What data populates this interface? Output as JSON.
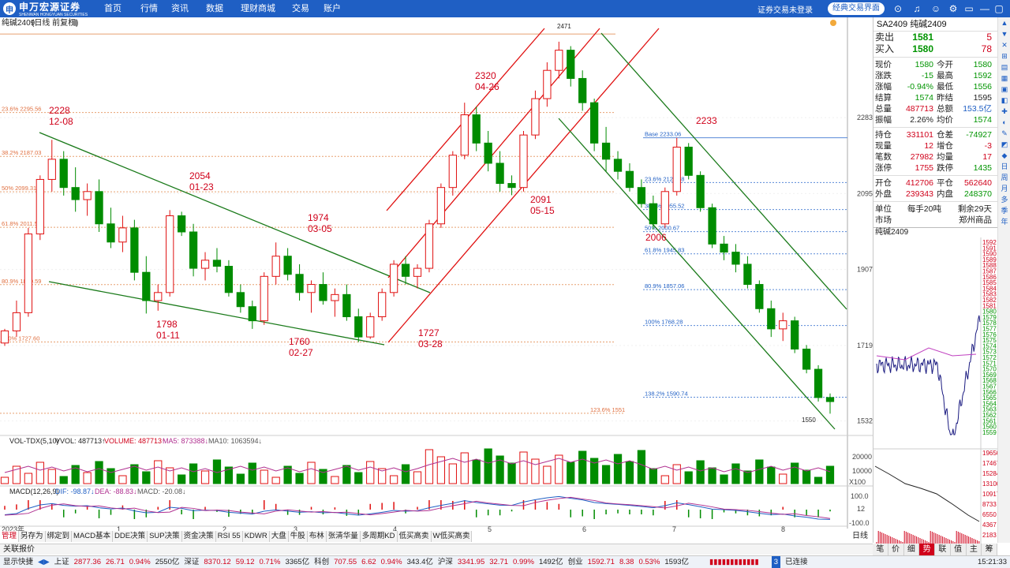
{
  "app": {
    "brand": "申万宏源证券",
    "brand_en": "SHENWAN HONGYUAN SECURITIES",
    "brand_short": "申"
  },
  "nav": [
    "首页",
    "行情",
    "资讯",
    "数据",
    "理财商城",
    "交易",
    "账户"
  ],
  "topbar": {
    "login_status": "证券交易未登录",
    "classic_button": "经典交易界面"
  },
  "window_controls": [
    "⊙",
    "♫",
    "☺",
    "⚙",
    "▭",
    "—",
    "▢",
    "✕"
  ],
  "colors": {
    "accent": "#1f5fc4",
    "up": "#d0021b",
    "down": "#009400",
    "fib": "#e07040"
  },
  "chart_header": {
    "symbol_label": "纯碱2409",
    "mode": "(日线 前复权)"
  },
  "chart_data": [
    {
      "type": "candlestick",
      "title": "纯碱2409",
      "y_axis_ticks": [
        "2283",
        "2095",
        "1907",
        "1719",
        "1532"
      ],
      "x_axis_ticks": [
        "2023年",
        "1",
        "2",
        "3",
        "4",
        "5",
        "6",
        "7",
        "8"
      ],
      "candles": [
        {
          "o": 1725,
          "h": 1760,
          "l": 1718,
          "c": 1755
        },
        {
          "o": 1755,
          "h": 1830,
          "l": 1740,
          "c": 1800
        },
        {
          "o": 1800,
          "h": 2010,
          "l": 1790,
          "c": 1995
        },
        {
          "o": 1995,
          "h": 2140,
          "l": 1980,
          "c": 2130
        },
        {
          "o": 2130,
          "h": 2228,
          "l": 2100,
          "c": 2180
        },
        {
          "o": 2180,
          "h": 2200,
          "l": 2090,
          "c": 2110
        },
        {
          "o": 2110,
          "h": 2160,
          "l": 2050,
          "c": 2080
        },
        {
          "o": 2080,
          "h": 2120,
          "l": 2040,
          "c": 2100
        },
        {
          "o": 2100,
          "h": 2130,
          "l": 2000,
          "c": 2020
        },
        {
          "o": 2020,
          "h": 2060,
          "l": 1960,
          "c": 1975
        },
        {
          "o": 1975,
          "h": 2040,
          "l": 1950,
          "c": 2010
        },
        {
          "o": 2010,
          "h": 2030,
          "l": 1880,
          "c": 1900
        },
        {
          "o": 1900,
          "h": 1940,
          "l": 1798,
          "c": 1830
        },
        {
          "o": 1830,
          "h": 1870,
          "l": 1805,
          "c": 1850
        },
        {
          "o": 1850,
          "h": 2054,
          "l": 1840,
          "c": 2040
        },
        {
          "o": 2040,
          "h": 2050,
          "l": 1990,
          "c": 2000
        },
        {
          "o": 2000,
          "h": 2020,
          "l": 1890,
          "c": 1910
        },
        {
          "o": 1910,
          "h": 1950,
          "l": 1880,
          "c": 1930
        },
        {
          "o": 1930,
          "h": 1960,
          "l": 1900,
          "c": 1915
        },
        {
          "o": 1915,
          "h": 1930,
          "l": 1840,
          "c": 1850
        },
        {
          "o": 1850,
          "h": 1870,
          "l": 1800,
          "c": 1815
        },
        {
          "o": 1815,
          "h": 1830,
          "l": 1760,
          "c": 1780
        },
        {
          "o": 1780,
          "h": 1900,
          "l": 1770,
          "c": 1890
        },
        {
          "o": 1890,
          "h": 1974,
          "l": 1870,
          "c": 1940
        },
        {
          "o": 1940,
          "h": 1960,
          "l": 1880,
          "c": 1895
        },
        {
          "o": 1895,
          "h": 1920,
          "l": 1830,
          "c": 1850
        },
        {
          "o": 1850,
          "h": 1880,
          "l": 1800,
          "c": 1870
        },
        {
          "o": 1870,
          "h": 1900,
          "l": 1820,
          "c": 1830
        },
        {
          "o": 1830,
          "h": 1860,
          "l": 1790,
          "c": 1845
        },
        {
          "o": 1845,
          "h": 1870,
          "l": 1780,
          "c": 1790
        },
        {
          "o": 1790,
          "h": 1810,
          "l": 1727,
          "c": 1740
        },
        {
          "o": 1740,
          "h": 1800,
          "l": 1735,
          "c": 1790
        },
        {
          "o": 1790,
          "h": 1860,
          "l": 1780,
          "c": 1850
        },
        {
          "o": 1850,
          "h": 1930,
          "l": 1840,
          "c": 1920
        },
        {
          "o": 1920,
          "h": 1940,
          "l": 1870,
          "c": 1890
        },
        {
          "o": 1890,
          "h": 1920,
          "l": 1860,
          "c": 1910
        },
        {
          "o": 1910,
          "h": 2030,
          "l": 1900,
          "c": 2020
        },
        {
          "o": 2020,
          "h": 2120,
          "l": 2010,
          "c": 2110
        },
        {
          "o": 2110,
          "h": 2200,
          "l": 2090,
          "c": 2190
        },
        {
          "o": 2190,
          "h": 2320,
          "l": 2180,
          "c": 2290
        },
        {
          "o": 2290,
          "h": 2310,
          "l": 2200,
          "c": 2220
        },
        {
          "o": 2220,
          "h": 2250,
          "l": 2150,
          "c": 2170
        },
        {
          "o": 2170,
          "h": 2200,
          "l": 2100,
          "c": 2120
        },
        {
          "o": 2120,
          "h": 2140,
          "l": 2091,
          "c": 2110
        },
        {
          "o": 2110,
          "h": 2250,
          "l": 2100,
          "c": 2240
        },
        {
          "o": 2240,
          "h": 2350,
          "l": 2230,
          "c": 2330
        },
        {
          "o": 2330,
          "h": 2420,
          "l": 2310,
          "c": 2400
        },
        {
          "o": 2400,
          "h": 2471,
          "l": 2380,
          "c": 2450
        },
        {
          "o": 2450,
          "h": 2460,
          "l": 2360,
          "c": 2380
        },
        {
          "o": 2380,
          "h": 2400,
          "l": 2300,
          "c": 2320
        },
        {
          "o": 2320,
          "h": 2330,
          "l": 2200,
          "c": 2220
        },
        {
          "o": 2220,
          "h": 2260,
          "l": 2150,
          "c": 2180
        },
        {
          "o": 2180,
          "h": 2200,
          "l": 2130,
          "c": 2150
        },
        {
          "o": 2150,
          "h": 2170,
          "l": 2100,
          "c": 2110
        },
        {
          "o": 2110,
          "h": 2130,
          "l": 2060,
          "c": 2070
        },
        {
          "o": 2070,
          "h": 2090,
          "l": 2006,
          "c": 2020
        },
        {
          "o": 2020,
          "h": 2110,
          "l": 2010,
          "c": 2100
        },
        {
          "o": 2100,
          "h": 2233,
          "l": 2090,
          "c": 2210
        },
        {
          "o": 2210,
          "h": 2220,
          "l": 2130,
          "c": 2140
        },
        {
          "o": 2140,
          "h": 2150,
          "l": 2050,
          "c": 2060
        },
        {
          "o": 2060,
          "h": 2070,
          "l": 1960,
          "c": 1970
        },
        {
          "o": 1970,
          "h": 1990,
          "l": 1930,
          "c": 1950
        },
        {
          "o": 1950,
          "h": 1970,
          "l": 1900,
          "c": 1920
        },
        {
          "o": 1920,
          "h": 1940,
          "l": 1860,
          "c": 1870
        },
        {
          "o": 1870,
          "h": 1880,
          "l": 1800,
          "c": 1810
        },
        {
          "o": 1810,
          "h": 1830,
          "l": 1740,
          "c": 1760
        },
        {
          "o": 1760,
          "h": 1800,
          "l": 1730,
          "c": 1780
        },
        {
          "o": 1780,
          "h": 1790,
          "l": 1700,
          "c": 1710
        },
        {
          "o": 1710,
          "h": 1720,
          "l": 1650,
          "c": 1660
        },
        {
          "o": 1660,
          "h": 1670,
          "l": 1580,
          "c": 1590
        },
        {
          "o": 1590,
          "h": 1600,
          "l": 1550,
          "c": 1580
        }
      ],
      "ylim": [
        1500,
        2500
      ],
      "annotations": [
        {
          "text": "2228",
          "sub": "12-08"
        },
        {
          "text": "1798",
          "sub": "01-11"
        },
        {
          "text": "2054",
          "sub": "01-23"
        },
        {
          "text": "1760",
          "sub": "02-27"
        },
        {
          "text": "1974",
          "sub": "03-05"
        },
        {
          "text": "1727",
          "sub": "03-28"
        },
        {
          "text": "2320",
          "sub": "04-26"
        },
        {
          "text": "2091",
          "sub": "05-15"
        },
        {
          "text": "2471",
          "sub": ""
        },
        {
          "text": "2006",
          "sub": ""
        },
        {
          "text": "2233",
          "sub": ""
        },
        {
          "text": "1550",
          "sub": ""
        }
      ],
      "fib_left": [
        "23.6% 2295.56",
        "38.2% 2187.03",
        "50% 2099.31",
        "61.8% 2011.59",
        "80.9% 1869.59",
        "100% 1727.60",
        "123.6% 1551"
      ],
      "fib_right": [
        "Base 2233.06",
        "23.6% 2122.38",
        "38.2% 2055.52",
        "50% 2000.67",
        "61.8% 1945.83",
        "80.9% 1857.06",
        "100% 1768.28",
        "138.2% 1590.74"
      ]
    }
  ],
  "volume": {
    "label": "VOL-TDX(5,10)",
    "vvol": "VVOL: 487713↑",
    "volume": "VOLUME: 487713↑",
    "ma5": "MA5: 873388↓",
    "ma10": "MA10: 1063594↓",
    "ticks": [
      "20000",
      "10000",
      "X100"
    ]
  },
  "macd": {
    "label": "MACD(12,26,9)",
    "dif": "DIF: -98.87↓",
    "dea": "DEA: -88.83↓",
    "macd": "MACD: -20.08↓",
    "ticks": [
      "100.0",
      "12",
      "-100.0"
    ]
  },
  "tabs": [
    "管理",
    "另存为",
    "绑定到",
    "MACD基本",
    "DDE决策",
    "SUP决策",
    "资金决策",
    "RSI 55",
    "KDWR",
    "大盘",
    "牛股",
    "布林",
    "张清华量",
    "多周期KD",
    "低买高卖",
    "W低买高卖"
  ],
  "relbar": {
    "label": "关联报价",
    "period": "日线"
  },
  "quote": {
    "title": "SA2409 纯碱2409",
    "sell": {
      "label": "卖出",
      "price": "1581",
      "vol": "5"
    },
    "buy": {
      "label": "买入",
      "price": "1580",
      "vol": "78"
    },
    "rows": [
      [
        "现价",
        "1580",
        "今开",
        "1580"
      ],
      [
        "涨跌",
        "-15",
        "最高",
        "1592"
      ],
      [
        "涨幅",
        "-0.94%",
        "最低",
        "1556"
      ],
      [
        "结算",
        "1574",
        "昨结",
        "1595"
      ],
      [
        "总量",
        "487713",
        "总额",
        "153.5亿"
      ],
      [
        "振幅",
        "2.26%",
        "均价",
        "1574"
      ]
    ],
    "rows2": [
      [
        "持仓",
        "331101",
        "仓差",
        "-74927"
      ],
      [
        "现量",
        "12",
        "增仓",
        "-3"
      ],
      [
        "笔数",
        "27982",
        "均量",
        "17"
      ],
      [
        "涨停",
        "1755",
        "跌停",
        "1435"
      ]
    ],
    "rows3": [
      [
        "开仓",
        "412706",
        "平仓",
        "562640"
      ],
      [
        "外盘",
        "239343",
        "内盘",
        "248370"
      ]
    ],
    "unit_label": "单位",
    "unit": "每手20吨",
    "remain": "剩余29天",
    "market_label": "市场",
    "market": "郑州商品"
  },
  "mini": {
    "title": "纯碱2409",
    "ticks": [
      "1592",
      "1591",
      "1590",
      "1589",
      "1588",
      "1587",
      "1586",
      "1585",
      "1584",
      "1583",
      "1582",
      "1581",
      "1580",
      "1579",
      "1578",
      "1577",
      "1576",
      "1575",
      "1574",
      "1573",
      "1572",
      "1571",
      "1570",
      "1569",
      "1568",
      "1567",
      "1566",
      "1565",
      "1564",
      "1563",
      "1562",
      "1561",
      "1560",
      "1559"
    ],
    "vol_ticks": [
      "19650",
      "17467",
      "15284",
      "13100",
      "10917",
      "8733",
      "6550",
      "4367",
      "2183"
    ]
  },
  "rtools": [
    "▲",
    "▼",
    "✕",
    "⊞",
    "▤",
    "▦",
    "▣",
    "◧",
    "✚",
    "◐",
    "✎",
    "◩",
    "◆",
    "日",
    "周",
    "月",
    "多",
    "季",
    "年"
  ],
  "rtabs": [
    "笔",
    "价",
    "细",
    "势",
    "联",
    "值",
    "主",
    "筹"
  ],
  "status": {
    "quick": "显示快捷",
    "sh": "上证",
    "sh_v": "2877.36",
    "sh_c": "26.71",
    "sh_p": "0.94%",
    "sh_a": "2550亿",
    "sz": "深证",
    "sz_v": "8370.12",
    "sz_c": "59.12",
    "sz_p": "0.71%",
    "sz_a": "3365亿",
    "kc": "科创",
    "kc_v": "707.55",
    "kc_c": "6.62",
    "kc_p": "0.94%",
    "kc_a": "343.4亿",
    "hs": "沪深",
    "hs_v": "3341.95",
    "hs_c": "32.71",
    "hs_p": "0.99%",
    "hs_a": "1492亿",
    "cy": "创业",
    "cy_v": "1592.71",
    "cy_c": "8.38",
    "cy_p": "0.53%",
    "cy_a": "1593亿",
    "conn": "已连接",
    "conn_n": "3",
    "time": "15:21:33"
  }
}
